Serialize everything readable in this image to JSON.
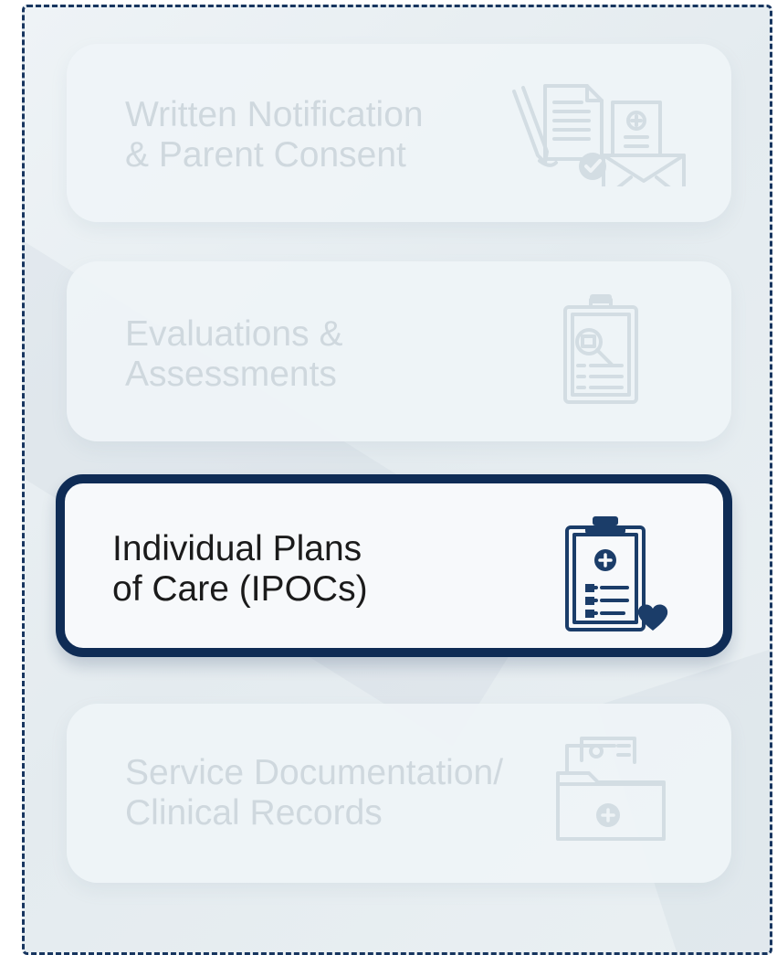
{
  "menu": {
    "items": [
      {
        "label": "Written Notification\n& Parent Consent",
        "icon": "document-pen-envelope-icon",
        "state": "inactive"
      },
      {
        "label": "Evaluations &\nAssessments",
        "icon": "clipboard-magnifier-icon",
        "state": "inactive"
      },
      {
        "label": "Individual Plans\nof Care (IPOCs)",
        "icon": "clipboard-heart-icon",
        "state": "active"
      },
      {
        "label": "Service Documentation/\nClinical Records",
        "icon": "medical-folder-icon",
        "state": "inactive"
      }
    ]
  },
  "colors": {
    "frame_border": "#17355f",
    "active_border": "#0f2c55",
    "inactive_text": "#cfd8de",
    "active_text": "#1b1b1b",
    "background": "#e8eef2"
  }
}
